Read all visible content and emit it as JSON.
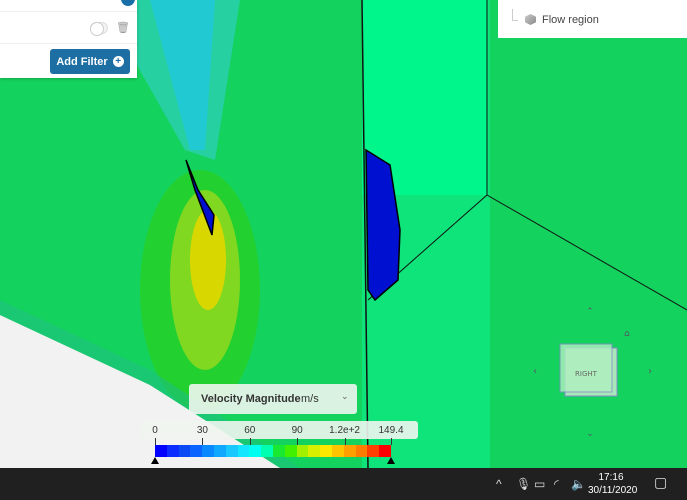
{
  "filter_panel": {
    "add_filter_label": "Add Filter",
    "add_icon": "+",
    "trash_icon": "trash-icon"
  },
  "tree": {
    "item_label": "Flow region",
    "item_icon": "cube-icon"
  },
  "legend": {
    "title": "Velocity Magnitude",
    "unit": "m/s",
    "ticks": [
      "0",
      "30",
      "60",
      "90",
      "1.2e+2",
      "149.4"
    ],
    "min": 0,
    "max": 149.4,
    "colors": [
      "#0000ff",
      "#0a2cff",
      "#0a4af5",
      "#0a64ff",
      "#0a88ff",
      "#10a8ff",
      "#18c8ff",
      "#14e6ff",
      "#00fff0",
      "#00ffb0",
      "#18e830",
      "#40f000",
      "#a0f000",
      "#d8f000",
      "#ffe800",
      "#ffc400",
      "#ffa000",
      "#ff7c00",
      "#ff4000",
      "#ff0000"
    ]
  },
  "viewcube": {
    "face_label": "RIGHT"
  },
  "taskbar": {
    "time": "17:16",
    "date": "30/11/2020"
  }
}
